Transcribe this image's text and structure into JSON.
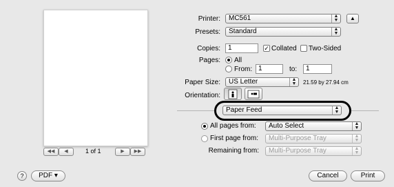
{
  "printer": {
    "label": "Printer:",
    "value": "MC561"
  },
  "presets": {
    "label": "Presets:",
    "value": "Standard"
  },
  "copies": {
    "label": "Copies:",
    "value": "1",
    "collated_label": "Collated",
    "collated_checked": true,
    "two_sided_label": "Two-Sided",
    "two_sided_checked": false
  },
  "pages": {
    "label": "Pages:",
    "all_label": "All",
    "from_label": "From:",
    "from_value": "1",
    "to_label": "to:",
    "to_value": "1"
  },
  "paper_size": {
    "label": "Paper Size:",
    "value": "US Letter",
    "dimensions": "21.59 by 27.94 cm"
  },
  "orientation": {
    "label": "Orientation:"
  },
  "section": {
    "value": "Paper Feed"
  },
  "feed": {
    "all_pages_label": "All pages from:",
    "all_pages_value": "Auto Select",
    "first_page_label": "First page from:",
    "first_page_value": "Multi-Purpose Tray",
    "remaining_label": "Remaining from:",
    "remaining_value": "Multi-Purpose Tray"
  },
  "preview": {
    "page_indicator": "1 of 1"
  },
  "footer": {
    "help": "?",
    "pdf_label": "PDF ▾",
    "cancel_label": "Cancel",
    "print_label": "Print"
  },
  "icons": {
    "stepper": "up-down-arrows-icon",
    "disclosure": "disclosure-triangle-icon"
  }
}
